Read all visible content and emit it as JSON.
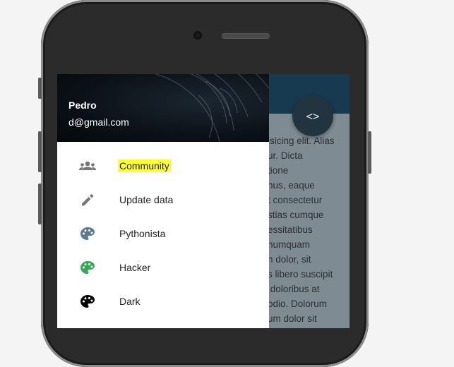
{
  "user": {
    "name": "Pedro",
    "email": "d@gmail.com"
  },
  "menu": [
    {
      "label": "Community",
      "icon": "people-icon",
      "highlighted": true
    },
    {
      "label": "Update data",
      "icon": "pencil-icon"
    },
    {
      "label": "Pythonista",
      "icon": "palette-icon",
      "color": "#5b7a8f"
    },
    {
      "label": "Hacker",
      "icon": "palette-icon",
      "color": "#3aa757"
    },
    {
      "label": "Dark",
      "icon": "palette-icon",
      "color": "#000000"
    }
  ],
  "fab": {
    "label": "<>"
  },
  "page": {
    "lines": [
      "isicing elit. Alias",
      "ur. Dicta",
      "tione",
      "hus, eaque",
      "t consectetur",
      "stias cumque",
      "essitatibus",
      "numquam",
      "n dolor, sit",
      "s libero suscipit",
      " doloribus at",
      "odio. Dolorum",
      "um dolor sit"
    ]
  },
  "colors": {
    "app_header": "#173a50",
    "fab_bg": "#22343f",
    "highlight": "#ffff2e"
  }
}
